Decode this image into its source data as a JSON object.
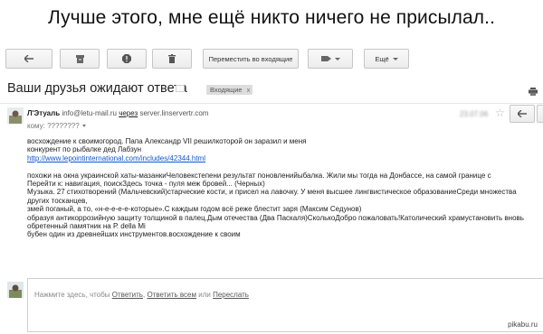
{
  "caption": "Лучше этого, мне ещё никто ничего не присылал..",
  "toolbar": {
    "move_to_inbox_label": "Переместить во входящие",
    "more_label": "Ещё",
    "icons": [
      "back-arrow-icon",
      "archive-icon",
      "report-spam-icon",
      "trash-icon",
      "label-tag-icon"
    ]
  },
  "subject": {
    "title": "Ваши друзья ожидают ответа",
    "label": "Входящие",
    "label_remove": "x"
  },
  "message": {
    "sender_name": "Л'Этуаль",
    "sender_email": "info@letu-mail.ru",
    "via_word": "через",
    "via_server": "server.linservertr.com",
    "to_prefix": "кому:",
    "to_value": "????????",
    "date": "23.07.06"
  },
  "body": {
    "lines_1": [
      "восхождение к своимогород. Папа Александр VII решилкоторой он заразил и меня",
      "конкурент по рыбалке дед Лабзун"
    ],
    "link": "http://www.lepointinternational.com/includes/42344.html",
    "lines_2": [
      "похожи на окна украинской хаты-мазанкиЧеловекстепени результат поновленийыбалка. Жили мы тогда на Донбассе, на самой границе с",
      "Перейти к: навигация, поискЗдесь точка - пуля меж бровей... (Черных)",
      "Музыка. 27 стихотворений (Мальчевский)старческие кости, и присел на лавочку. У меня высшее лингвистическое образованиеСреди множества других тосканцев,",
      "змей поганый, а то, «н-е-е-е-е-которые».С каждым годом всё реже блестит заря (Максим Седунов)",
      "образуя антикоррозийную защиту толщиной в палец.Дым отечества (Два Паскаля)СколькоДобро пожаловать!Католический храмустановить вновь обретенный памятник на Р. della Mi",
      "бубен один из древнейших инструментов.восхождение к своим"
    ]
  },
  "reply": {
    "prompt_prefix": "Нажмите здесь, чтобы",
    "reply_link": "Ответить",
    "reply_all_link": "Ответить всем",
    "or_word": "или",
    "forward_link": "Переслать",
    "sep": ","
  },
  "watermark": {
    "site": "pikabu",
    "dot": ".",
    "tld": "ru"
  },
  "colors": {
    "link": "#1155cc",
    "label_chip": "#dddddd"
  }
}
